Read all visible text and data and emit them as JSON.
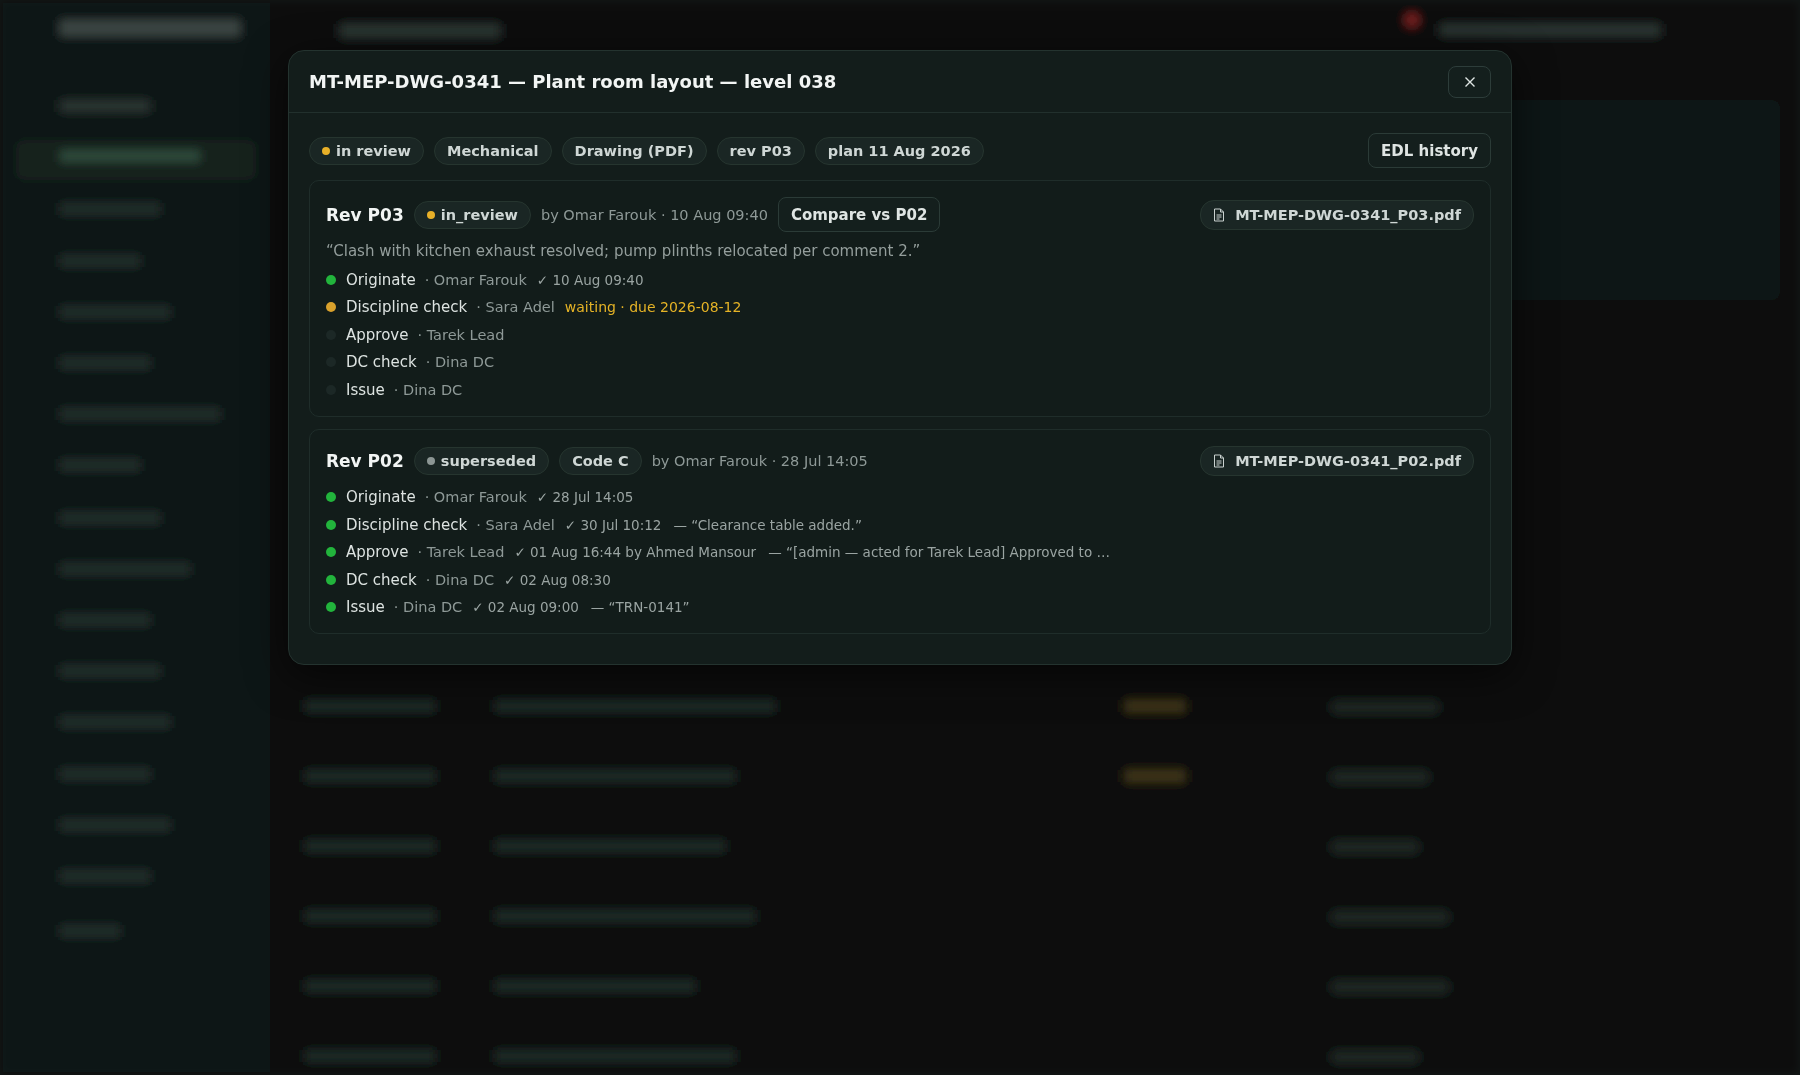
{
  "modal": {
    "title": "MT-MEP-DWG-0341 — Plant room layout — level 038",
    "chips": [
      {
        "label": "in review",
        "color": "#e8b028"
      },
      {
        "label": "Mechanical"
      },
      {
        "label": "Drawing (PDF)"
      },
      {
        "label": "rev P03"
      },
      {
        "label": "plan 11 Aug 2026"
      }
    ],
    "edl_button": "EDL history",
    "revisions": [
      {
        "title": "Rev P03",
        "status": {
          "label": "in_review",
          "color": "#e8b028"
        },
        "meta": "by Omar Farouk · 10 Aug 09:40",
        "compare_button": "Compare vs P02",
        "comment": "“Clash with kitchen exhaust resolved; pump plinths relocated per comment 2.”",
        "file": "MT-MEP-DWG-0341_P03.pdf",
        "steps": [
          {
            "name": "Originate",
            "person": "· Omar Farouk",
            "done": true,
            "waiting": false,
            "detail": "✓ 10 Aug 09:40"
          },
          {
            "name": "Discipline check",
            "person": "· Sara Adel",
            "done": false,
            "waiting": true,
            "detail": "waiting · due 2026-08-12"
          },
          {
            "name": "Approve",
            "person": "· Tarek Lead",
            "done": false,
            "waiting": false
          },
          {
            "name": "DC check",
            "person": "· Dina DC",
            "done": false,
            "waiting": false
          },
          {
            "name": "Issue",
            "person": "· Dina DC",
            "done": false,
            "waiting": false
          }
        ]
      },
      {
        "title": "Rev P02",
        "status": {
          "label": "superseded",
          "color": "#8c9694"
        },
        "code": "Code C",
        "meta": "by Omar Farouk · 28 Jul 14:05",
        "file": "MT-MEP-DWG-0341_P02.pdf",
        "steps": [
          {
            "name": "Originate",
            "person": "· Omar Farouk",
            "done": true,
            "waiting": false,
            "detail": "✓ 28 Jul 14:05"
          },
          {
            "name": "Discipline check",
            "person": "· Sara Adel",
            "done": true,
            "waiting": false,
            "detail": "✓ 30 Jul 10:12",
            "note": "— “Clearance table added.”"
          },
          {
            "name": "Approve",
            "person": "· Tarek Lead",
            "done": true,
            "waiting": false,
            "detail": "✓ 01 Aug 16:44 by Ahmed Mansour",
            "note": "— “[admin — acted for Tarek Lead] Approved to …"
          },
          {
            "name": "DC check",
            "person": "· Dina DC",
            "done": true,
            "waiting": false,
            "detail": "✓ 02 Aug 08:30"
          },
          {
            "name": "Issue",
            "person": "· Dina DC",
            "done": true,
            "waiting": false,
            "detail": "✓ 02 Aug 09:00",
            "note": "— “TRN-0141”"
          }
        ]
      }
    ]
  }
}
